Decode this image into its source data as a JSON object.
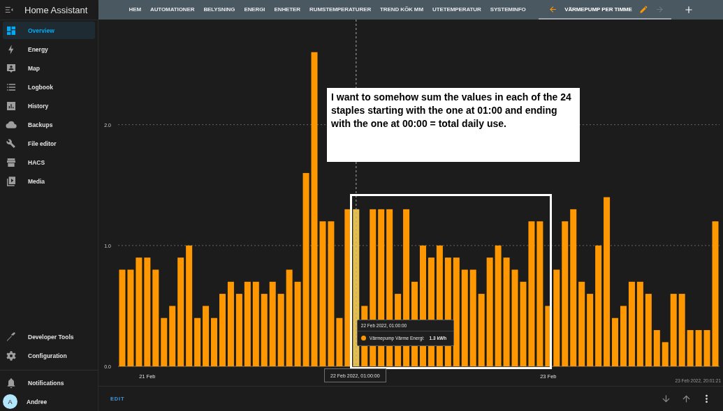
{
  "sidebar": {
    "title": "Home Assistant",
    "items": [
      {
        "label": "Overview",
        "kind": "dashboard",
        "selected": true
      },
      {
        "label": "Energy",
        "kind": "bolt",
        "selected": false
      },
      {
        "label": "Map",
        "kind": "map",
        "selected": false
      },
      {
        "label": "Logbook",
        "kind": "list",
        "selected": false
      },
      {
        "label": "History",
        "kind": "chart",
        "selected": false
      },
      {
        "label": "Backups",
        "kind": "cloud",
        "selected": false
      },
      {
        "label": "File editor",
        "kind": "wrench",
        "selected": false
      },
      {
        "label": "HACS",
        "kind": "store",
        "selected": false
      },
      {
        "label": "Media",
        "kind": "media",
        "selected": false
      }
    ],
    "bottom_items": [
      {
        "label": "Developer Tools",
        "kind": "hammer",
        "selected": false
      },
      {
        "label": "Configuration",
        "kind": "gear",
        "selected": false
      }
    ],
    "notifications": {
      "label": "Notifications"
    },
    "user": {
      "initial": "A",
      "name": "Andree"
    }
  },
  "tabs": [
    {
      "label": "HEM",
      "selected": false
    },
    {
      "label": "AUTOMATIONER",
      "selected": false
    },
    {
      "label": "BELYSNING",
      "selected": false
    },
    {
      "label": "ENERGI",
      "selected": false
    },
    {
      "label": "ENHETER",
      "selected": false
    },
    {
      "label": "RUMSTEMPERATURER",
      "selected": false
    },
    {
      "label": "TREND KÖK MM",
      "selected": false
    },
    {
      "label": "UTETEMPERATUR",
      "selected": false
    },
    {
      "label": "SYSTEMINFO",
      "selected": false
    },
    {
      "label": "VÄRMEPUMP PER TIMME",
      "selected": true
    }
  ],
  "card": {
    "chart_data": {
      "type": "bar",
      "ylim": [
        0,
        2.87
      ],
      "yticks": [
        {
          "value": 0,
          "label": "0.0"
        },
        {
          "value": 1,
          "label": "1.0"
        },
        {
          "value": 2,
          "label": "2.0"
        }
      ],
      "categories": [
        null,
        null,
        null,
        "21 Feb",
        null,
        null,
        null,
        null,
        null,
        null,
        null,
        null,
        null,
        null,
        null,
        null,
        null,
        null,
        null,
        null,
        null,
        null,
        null,
        null,
        null,
        null,
        null,
        null,
        null,
        null,
        null,
        null,
        null,
        null,
        null,
        null,
        null,
        null,
        null,
        null,
        null,
        null,
        null,
        null,
        null,
        null,
        null,
        null,
        null,
        null,
        null,
        "23 Feb",
        null,
        null,
        null,
        null,
        null,
        null,
        null,
        null,
        null,
        null,
        null,
        null,
        null,
        null,
        null,
        null,
        null,
        null,
        null,
        null
      ],
      "series": [
        {
          "name": "Värmepump Värme Energi",
          "color": "#ff9800",
          "values": [
            0.8,
            0.8,
            0.9,
            0.9,
            0.8,
            0.4,
            0.5,
            0.9,
            1.0,
            0.4,
            0.5,
            0.4,
            0.6,
            0.7,
            0.6,
            0.7,
            0.7,
            0.6,
            0.7,
            0.6,
            0.8,
            0.7,
            1.6,
            2.6,
            1.2,
            1.2,
            0.4,
            1.3,
            1.3,
            0.5,
            1.3,
            1.3,
            1.3,
            0.6,
            1.3,
            0.7,
            1.0,
            0.9,
            1.0,
            0.9,
            0.9,
            0.8,
            0.8,
            0.6,
            0.9,
            1.0,
            0.9,
            0.8,
            0.7,
            1.2,
            1.2,
            0.5,
            0.8,
            1.2,
            1.3,
            0.7,
            0.6,
            1.0,
            1.4,
            0.4,
            0.5,
            0.7,
            0.7,
            0.6,
            0.3,
            0.2,
            0.6,
            0.6,
            0.3,
            0.3,
            0.3,
            1.2
          ]
        }
      ]
    },
    "tooltip": {
      "title": "22 Feb 2022, 01:00:00",
      "name_suffix": ":",
      "value": "1.3 kWh",
      "color": "#ff9800"
    },
    "cursor": {
      "label": "22 Feb 2022, 01:00:00",
      "level": 0.396
    },
    "timestamp": "23 Feb 2022, 20:01:21",
    "annotation": "I want to somehow sum the values in each of the 24 staples starting with the one at 01:00 and ending with the one at 00:00 = total daily use.",
    "edit_button": "EDIT"
  }
}
